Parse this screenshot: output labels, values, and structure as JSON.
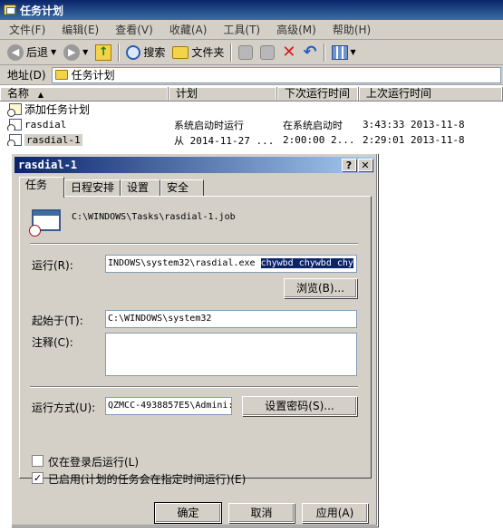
{
  "window": {
    "title": "任务计划"
  },
  "menu": [
    "文件(F)",
    "编辑(E)",
    "查看(V)",
    "收藏(A)",
    "工具(T)",
    "高级(M)",
    "帮助(H)"
  ],
  "toolbar": {
    "back_label": "后退",
    "search_label": "搜索",
    "folders_label": "文件夹"
  },
  "address": {
    "label": "地址(D)",
    "value": "任务计划"
  },
  "list": {
    "columns": [
      "名称",
      "计划",
      "下次运行时间",
      "上次运行时间"
    ],
    "rows": [
      {
        "name": "添加任务计划",
        "schedule": "",
        "next_run": "",
        "last_run": ""
      },
      {
        "name": "rasdial",
        "schedule": "系统启动时运行",
        "next_run": "在系统启动时",
        "last_run": "3:43:33  2013-11-8"
      },
      {
        "name": "rasdial-1",
        "schedule": "从 2014-11-27 ...",
        "next_run": "2:00:00  2...",
        "last_run": "2:29:01  2013-11-8"
      }
    ]
  },
  "dialog": {
    "title": "rasdial-1",
    "help_button": "?",
    "close_button": "✕",
    "tabs": [
      "任务",
      "日程安排",
      "设置",
      "安全"
    ],
    "job_path": "C:\\WINDOWS\\Tasks\\rasdial-1.job",
    "run_label": "运行(R):",
    "run_value_plain": "INDOWS\\system32\\rasdial.exe ",
    "run_value_selected": "chywbd chywbd chy",
    "browse_button": "浏览(B)...",
    "start_in_label": "起始于(T):",
    "start_in_value": "C:\\WINDOWS\\system32",
    "comments_label": "注释(C):",
    "comments_value": "",
    "run_as_label": "运行方式(U):",
    "run_as_value": "QZMCC-4938857E5\\Admini:",
    "set_password_button": "设置密码(S)...",
    "logged_on_only_label": "仅在登录后运行(L)",
    "logged_on_only_checked": false,
    "enabled_label": "已启用(计划的任务会在指定时间运行)(E)",
    "enabled_checked": true,
    "ok_button": "确定",
    "cancel_button": "取消",
    "apply_button": "应用(A)"
  }
}
